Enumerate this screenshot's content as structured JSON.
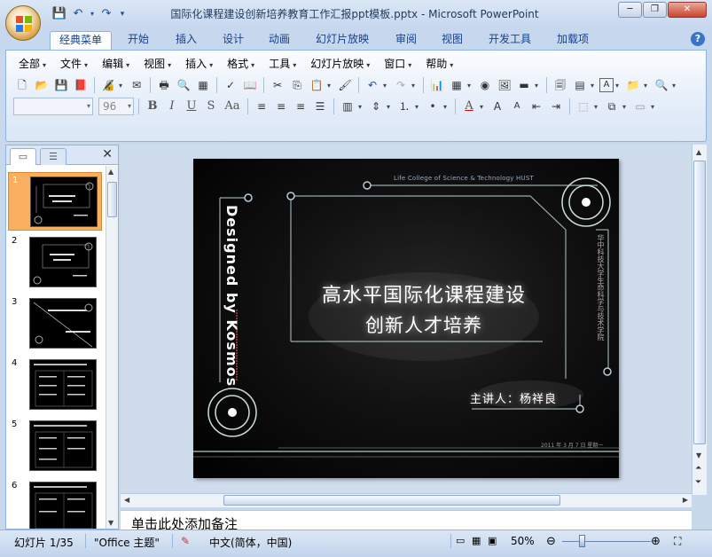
{
  "window": {
    "title": "国际化课程建设创新培养教育工作汇报ppt模板.pptx - Microsoft PowerPoint",
    "minimize": "─",
    "restore": "❐",
    "close": "✕"
  },
  "tabs": [
    {
      "label": "经典菜单",
      "active": true
    },
    {
      "label": "开始"
    },
    {
      "label": "插入"
    },
    {
      "label": "设计"
    },
    {
      "label": "动画"
    },
    {
      "label": "幻灯片放映"
    },
    {
      "label": "审阅"
    },
    {
      "label": "视图"
    },
    {
      "label": "开发工具"
    },
    {
      "label": "加载项"
    }
  ],
  "help": "?",
  "menus": [
    "全部",
    "文件",
    "编辑",
    "视图",
    "插入",
    "格式",
    "工具",
    "幻灯片放映",
    "窗口",
    "帮助"
  ],
  "font": {
    "name": "",
    "size": "96"
  },
  "format_buttons": {
    "bold": "B",
    "italic": "I",
    "underline": "U",
    "shadow": "S",
    "case": "Aa",
    "color": "A"
  },
  "thumbnails": [
    "1",
    "2",
    "3",
    "4",
    "5",
    "6"
  ],
  "slide": {
    "title_line1": "高水平国际化课程建设",
    "title_line2": "创新人才培养",
    "presenter": "主讲人：杨祥良",
    "college": "Life College of Science & Technology   HUST",
    "vertical_cn": "华中科技大学生命科学与技术学院",
    "designed_by": "Designed by Kosmos",
    "date": "2011 年 3 月 7 日     星期一"
  },
  "notes_placeholder": "单击此处添加备注",
  "status": {
    "slide_info": "幻灯片 1/35",
    "theme": "\"Office 主题\"",
    "language": "中文(简体，中国)",
    "zoom": "50%"
  },
  "colors": {
    "accent": "#15428b",
    "selected_thumb": "#f8b060",
    "slide_bg": "#000000"
  }
}
